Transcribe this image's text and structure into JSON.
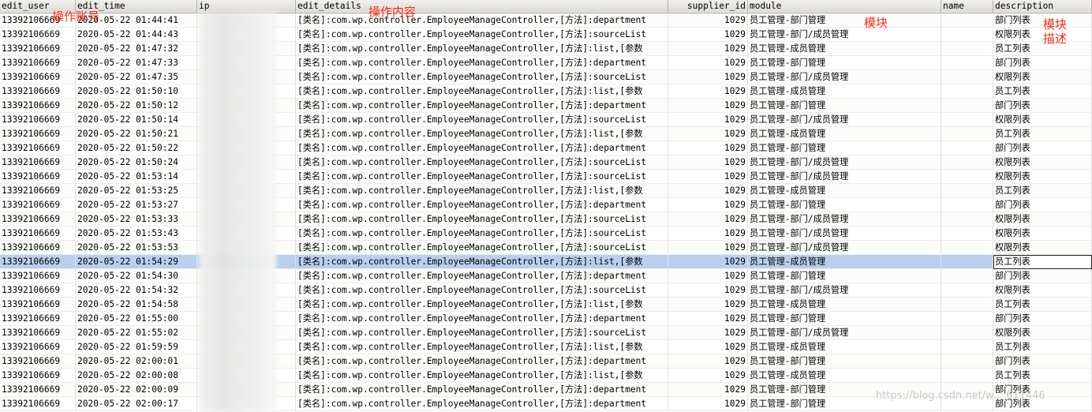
{
  "columns": [
    "edit_user",
    "edit_time",
    "ip",
    "edit_details",
    "supplier_id",
    "module",
    "name",
    "description"
  ],
  "rows": [
    {
      "user": "13392106669",
      "time": "2020-05-22 01:44:41",
      "ip": "",
      "details": "[类名]:com.wp.controller.EmployeeManageController,[方法]:department",
      "supplier": "1029",
      "module": "员工管理-部门管理",
      "name": "",
      "desc": "部门列表"
    },
    {
      "user": "13392106669",
      "time": "2020-05-22 01:44:43",
      "ip": "",
      "details": "[类名]:com.wp.controller.EmployeeManageController,[方法]:sourceList",
      "supplier": "1029",
      "module": "员工管理-部门/成员管理",
      "name": "",
      "desc": "权限列表"
    },
    {
      "user": "13392106669",
      "time": "2020-05-22 01:47:32",
      "ip": "",
      "details": "[类名]:com.wp.controller.EmployeeManageController,[方法]:list,[参数",
      "supplier": "1029",
      "module": "员工管理-成员管理",
      "name": "",
      "desc": "员工列表"
    },
    {
      "user": "13392106669",
      "time": "2020-05-22 01:47:33",
      "ip": "",
      "details": "[类名]:com.wp.controller.EmployeeManageController,[方法]:department",
      "supplier": "1029",
      "module": "员工管理-部门管理",
      "name": "",
      "desc": "部门列表"
    },
    {
      "user": "13392106669",
      "time": "2020-05-22 01:47:35",
      "ip": "",
      "details": "[类名]:com.wp.controller.EmployeeManageController,[方法]:sourceList",
      "supplier": "1029",
      "module": "员工管理-部门/成员管理",
      "name": "",
      "desc": "权限列表"
    },
    {
      "user": "13392106669",
      "time": "2020-05-22 01:50:10",
      "ip": "",
      "details": "[类名]:com.wp.controller.EmployeeManageController,[方法]:list,[参数",
      "supplier": "1029",
      "module": "员工管理-成员管理",
      "name": "",
      "desc": "员工列表"
    },
    {
      "user": "13392106669",
      "time": "2020-05-22 01:50:12",
      "ip": "",
      "details": "[类名]:com.wp.controller.EmployeeManageController,[方法]:department",
      "supplier": "1029",
      "module": "员工管理-部门管理",
      "name": "",
      "desc": "部门列表"
    },
    {
      "user": "13392106669",
      "time": "2020-05-22 01:50:14",
      "ip": "",
      "details": "[类名]:com.wp.controller.EmployeeManageController,[方法]:sourceList",
      "supplier": "1029",
      "module": "员工管理-部门/成员管理",
      "name": "",
      "desc": "权限列表"
    },
    {
      "user": "13392106669",
      "time": "2020-05-22 01:50:21",
      "ip": "",
      "details": "[类名]:com.wp.controller.EmployeeManageController,[方法]:list,[参数",
      "supplier": "1029",
      "module": "员工管理-成员管理",
      "name": "",
      "desc": "员工列表"
    },
    {
      "user": "13392106669",
      "time": "2020-05-22 01:50:22",
      "ip": "",
      "details": "[类名]:com.wp.controller.EmployeeManageController,[方法]:department",
      "supplier": "1029",
      "module": "员工管理-部门管理",
      "name": "",
      "desc": "部门列表"
    },
    {
      "user": "13392106669",
      "time": "2020-05-22 01:50:24",
      "ip": "",
      "details": "[类名]:com.wp.controller.EmployeeManageController,[方法]:sourceList",
      "supplier": "1029",
      "module": "员工管理-部门/成员管理",
      "name": "",
      "desc": "权限列表"
    },
    {
      "user": "13392106669",
      "time": "2020-05-22 01:53:14",
      "ip": "",
      "details": "[类名]:com.wp.controller.EmployeeManageController,[方法]:sourceList",
      "supplier": "1029",
      "module": "员工管理-部门/成员管理",
      "name": "",
      "desc": "权限列表"
    },
    {
      "user": "13392106669",
      "time": "2020-05-22 01:53:25",
      "ip": "",
      "details": "[类名]:com.wp.controller.EmployeeManageController,[方法]:list,[参数",
      "supplier": "1029",
      "module": "员工管理-成员管理",
      "name": "",
      "desc": "员工列表"
    },
    {
      "user": "13392106669",
      "time": "2020-05-22 01:53:27",
      "ip": "",
      "details": "[类名]:com.wp.controller.EmployeeManageController,[方法]:department",
      "supplier": "1029",
      "module": "员工管理-部门管理",
      "name": "",
      "desc": "部门列表"
    },
    {
      "user": "13392106669",
      "time": "2020-05-22 01:53:33",
      "ip": "",
      "details": "[类名]:com.wp.controller.EmployeeManageController,[方法]:sourceList",
      "supplier": "1029",
      "module": "员工管理-部门/成员管理",
      "name": "",
      "desc": "权限列表"
    },
    {
      "user": "13392106669",
      "time": "2020-05-22 01:53:43",
      "ip": "",
      "details": "[类名]:com.wp.controller.EmployeeManageController,[方法]:sourceList",
      "supplier": "1029",
      "module": "员工管理-部门/成员管理",
      "name": "",
      "desc": "权限列表"
    },
    {
      "user": "13392106669",
      "time": "2020-05-22 01:53:53",
      "ip": "",
      "details": "[类名]:com.wp.controller.EmployeeManageController,[方法]:sourceList",
      "supplier": "1029",
      "module": "员工管理-部门/成员管理",
      "name": "",
      "desc": "权限列表"
    },
    {
      "user": "13392106669",
      "time": "2020-05-22 01:54:29",
      "ip": "",
      "details": "[类名]:com.wp.controller.EmployeeManageController,[方法]:list,[参数",
      "supplier": "1029",
      "module": "员工管理-成员管理",
      "name": "",
      "desc": "员工列表",
      "selected": true
    },
    {
      "user": "13392106669",
      "time": "2020-05-22 01:54:30",
      "ip": "",
      "details": "[类名]:com.wp.controller.EmployeeManageController,[方法]:department",
      "supplier": "1029",
      "module": "员工管理-部门管理",
      "name": "",
      "desc": "部门列表"
    },
    {
      "user": "13392106669",
      "time": "2020-05-22 01:54:32",
      "ip": "",
      "details": "[类名]:com.wp.controller.EmployeeManageController,[方法]:sourceList",
      "supplier": "1029",
      "module": "员工管理-部门/成员管理",
      "name": "",
      "desc": "权限列表"
    },
    {
      "user": "13392106669",
      "time": "2020-05-22 01:54:58",
      "ip": "",
      "details": "[类名]:com.wp.controller.EmployeeManageController,[方法]:list,[参数",
      "supplier": "1029",
      "module": "员工管理-成员管理",
      "name": "",
      "desc": "员工列表"
    },
    {
      "user": "13392106669",
      "time": "2020-05-22 01:55:00",
      "ip": "",
      "details": "[类名]:com.wp.controller.EmployeeManageController,[方法]:department",
      "supplier": "1029",
      "module": "员工管理-部门管理",
      "name": "",
      "desc": "部门列表"
    },
    {
      "user": "13392106669",
      "time": "2020-05-22 01:55:02",
      "ip": "",
      "details": "[类名]:com.wp.controller.EmployeeManageController,[方法]:sourceList",
      "supplier": "1029",
      "module": "员工管理-部门/成员管理",
      "name": "",
      "desc": "权限列表"
    },
    {
      "user": "13392106669",
      "time": "2020-05-22 01:59:59",
      "ip": "",
      "details": "[类名]:com.wp.controller.EmployeeManageController,[方法]:list,[参数",
      "supplier": "1029",
      "module": "员工管理-成员管理",
      "name": "",
      "desc": "员工列表"
    },
    {
      "user": "13392106669",
      "time": "2020-05-22 02:00:01",
      "ip": "",
      "details": "[类名]:com.wp.controller.EmployeeManageController,[方法]:department",
      "supplier": "1029",
      "module": "员工管理-部门管理",
      "name": "",
      "desc": "部门列表"
    },
    {
      "user": "13392106669",
      "time": "2020-05-22 02:00:08",
      "ip": "",
      "details": "[类名]:com.wp.controller.EmployeeManageController,[方法]:list,[参数",
      "supplier": "1029",
      "module": "员工管理-成员管理",
      "name": "",
      "desc": "员工列表"
    },
    {
      "user": "13392106669",
      "time": "2020-05-22 02:00:09",
      "ip": "",
      "details": "[类名]:com.wp.controller.EmployeeManageController,[方法]:department",
      "supplier": "1029",
      "module": "员工管理-部门管理",
      "name": "",
      "desc": "部门列表"
    },
    {
      "user": "13392106669",
      "time": "2020-05-22 02:00:17",
      "ip": "",
      "details": "[类名]:com.wp.controller.EmployeeManageController,[方法]:department",
      "supplier": "1029",
      "module": "员工管理-部门管理",
      "name": "",
      "desc": "部门列表"
    }
  ],
  "annotations": {
    "account": "操作账号",
    "content": "操作内容",
    "module": "模块",
    "desc": "模块描述"
  },
  "watermark": "https://blog.csdn.net/w... 611446"
}
